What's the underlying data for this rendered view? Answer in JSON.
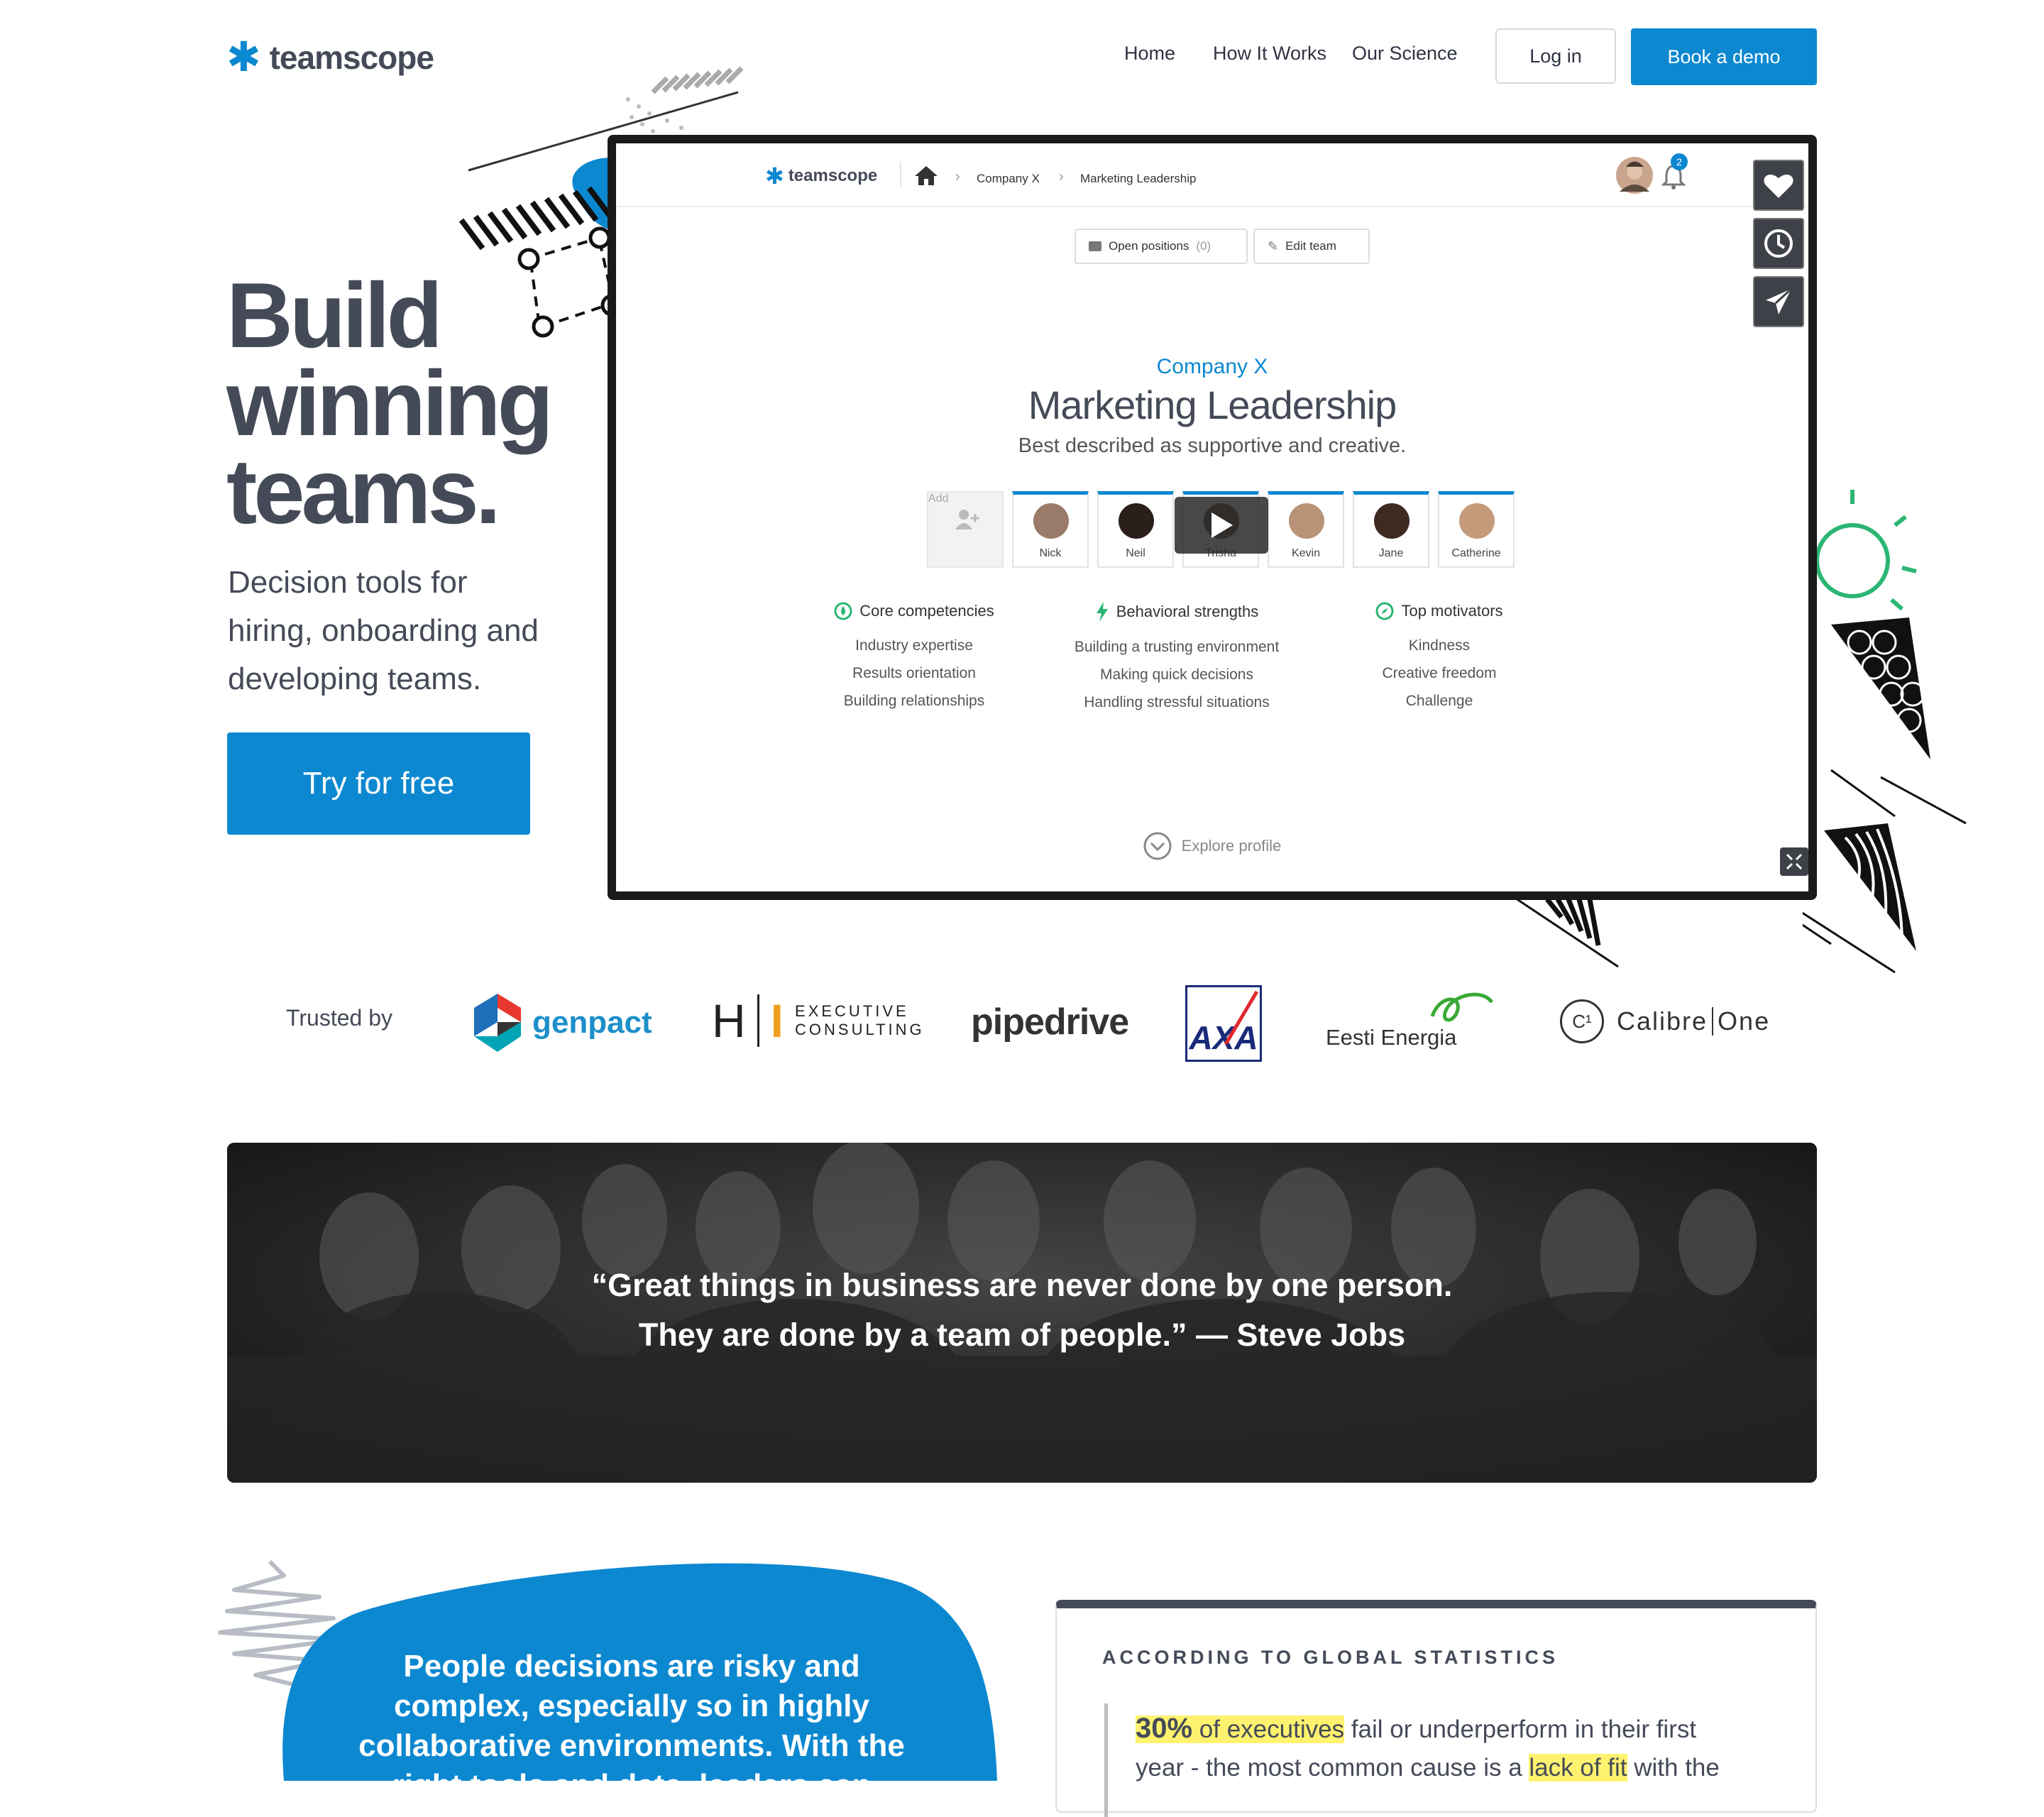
{
  "nav": {
    "logo_text": "teamscope",
    "links": [
      "Home",
      "How It Works",
      "Our Science"
    ],
    "login_label": "Log in",
    "demo_label": "Book a demo"
  },
  "hero": {
    "title_lines": [
      "Build",
      "winning",
      "teams."
    ],
    "subtitle_lines": [
      "Decision tools for",
      "hiring, onboarding and",
      "developing teams."
    ],
    "cta_label": "Try for free"
  },
  "app_mockup": {
    "logo_text": "teamscope",
    "breadcrumb": [
      "Company X",
      "Marketing Leadership"
    ],
    "notification_count": "2",
    "open_positions_label": "Open positions",
    "open_positions_count": "(0)",
    "edit_team_label": "Edit team",
    "company": "Company X",
    "team_name": "Marketing Leadership",
    "team_description": "Best described as supportive and creative.",
    "add_label": "Add",
    "members": [
      "Nick",
      "Neil",
      "Trisha",
      "Kevin",
      "Jane",
      "Catherine"
    ],
    "columns": [
      {
        "heading": "Core competencies",
        "icon": "drop-icon",
        "items": [
          "Industry expertise",
          "Results orientation",
          "Building relationships"
        ]
      },
      {
        "heading": "Behavioral strengths",
        "icon": "bolt-icon",
        "items": [
          "Building a trusting environment",
          "Making quick decisions",
          "Handling stressful situations"
        ]
      },
      {
        "heading": "Top motivators",
        "icon": "compass-icon",
        "items": [
          "Kindness",
          "Creative freedom",
          "Challenge"
        ]
      }
    ],
    "explore_label": "Explore profile"
  },
  "trusted": {
    "label": "Trusted by",
    "logos": {
      "genpact": "genpact",
      "hi_h": "H",
      "hi_i": "I",
      "hi_line1": "EXECUTIVE",
      "hi_line2": "CONSULTING",
      "pipedrive": "pipedrive",
      "axa": "AXA",
      "eesti": "Eesti Energia",
      "calibre_mark": "C¹",
      "calibre_a": "Calibre",
      "calibre_b": "One"
    }
  },
  "quote": {
    "line1": "“Great things in business are never done by one person.",
    "line2": "They are done by a team of people.” — Steve Jobs"
  },
  "problem": {
    "lines": [
      "People decisions are risky and",
      "complex, especially so in highly",
      "collaborative environments. With the",
      "right tools and data, leaders can"
    ]
  },
  "stats": {
    "heading": "ACCORDING TO GLOBAL STATISTICS",
    "pct": "30%",
    "pct_suffix": " of executives",
    "text1": " fail or underperform in their first",
    "text2": "year - the most common cause is a ",
    "highlight2": "lack of fit",
    "text3": " with the"
  },
  "colors": {
    "brand_blue": "#0c88d0",
    "text_dark": "#454a58",
    "highlight": "#fff26e",
    "accent_green": "#2bb673"
  }
}
